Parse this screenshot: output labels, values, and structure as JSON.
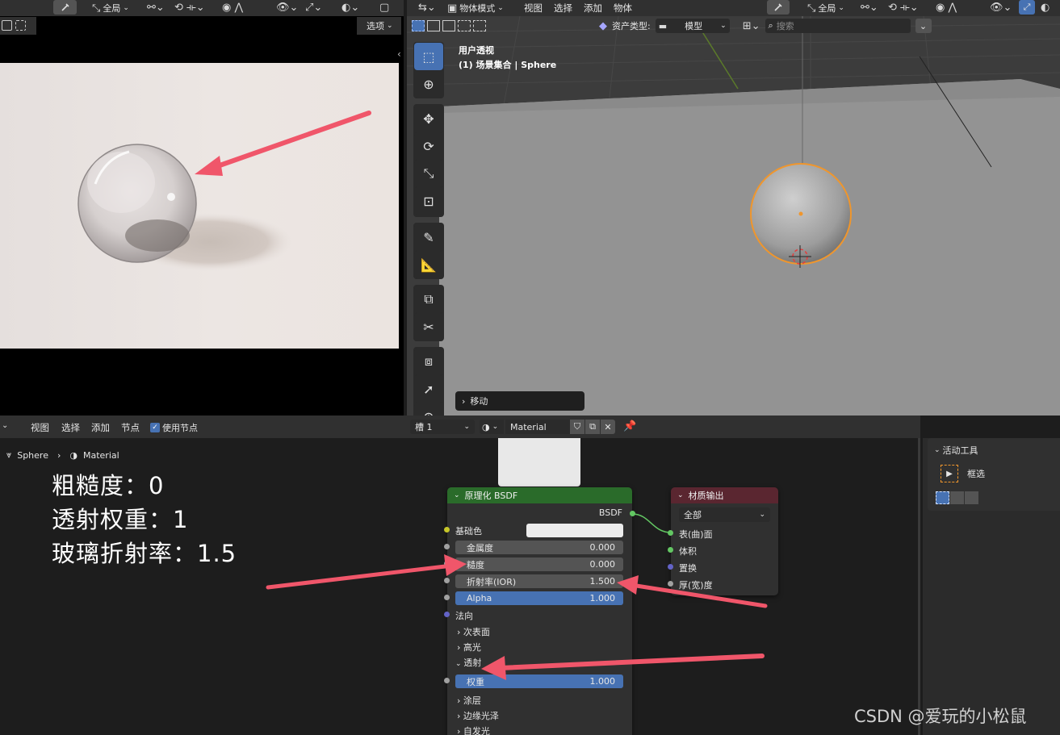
{
  "image_editor": {
    "header": {
      "global_label": "全局",
      "options_label": "选项"
    }
  },
  "viewport": {
    "header": {
      "mode_label": "物体模式",
      "menus": [
        "视图",
        "选择",
        "添加",
        "物体"
      ],
      "global_label": "全局"
    },
    "asset_bar": {
      "asset_type_label": "资产类型:",
      "asset_type_value": "模型",
      "search_placeholder": "搜索"
    },
    "overlay_title": "用户透视",
    "overlay_subtitle": "(1) 场景集合 | Sphere",
    "last_op": "移动"
  },
  "node_editor": {
    "header": {
      "menus": [
        "视图",
        "选择",
        "添加",
        "节点"
      ],
      "use_nodes_label": "使用节点",
      "use_nodes_checked": true,
      "slot_label": "槽 1",
      "material_name": "Material"
    },
    "breadcrumb": {
      "object": "Sphere",
      "material": "Material"
    },
    "bsdf_node": {
      "title": "原理化 BSDF",
      "output_label": "BSDF",
      "base_color_label": "基础色",
      "fields": [
        {
          "label": "金属度",
          "value": "0.000"
        },
        {
          "label": "糙度",
          "value": "0.000"
        },
        {
          "label": "折射率(IOR)",
          "value": "1.500"
        },
        {
          "label": "Alpha",
          "value": "1.000"
        }
      ],
      "normal_label": "法向",
      "panels_before": [
        "次表面",
        "高光"
      ],
      "transmission_panel": "透射",
      "transmission_weight": {
        "label": "权重",
        "value": "1.000"
      },
      "panels_after": [
        "涂层",
        "边缘光泽",
        "自发光"
      ]
    },
    "output_node": {
      "title": "材质输出",
      "target": "全部",
      "sockets": [
        "表(曲)面",
        "体积",
        "置换",
        "厚(宽)度"
      ]
    }
  },
  "sidebar": {
    "title": "活动工具",
    "tool_name": "框选"
  },
  "annotations": [
    "粗糙度：0",
    "透射权重：1",
    "玻璃折射率：1.5"
  ],
  "watermark": "CSDN @爱玩的小松鼠",
  "colors": {
    "bsdf_header": "#2a6b2a",
    "output_header": "#5a2630",
    "accent_blue": "#4772b3",
    "arrow_red": "#f0566a",
    "selection_orange": "#f0962c"
  }
}
